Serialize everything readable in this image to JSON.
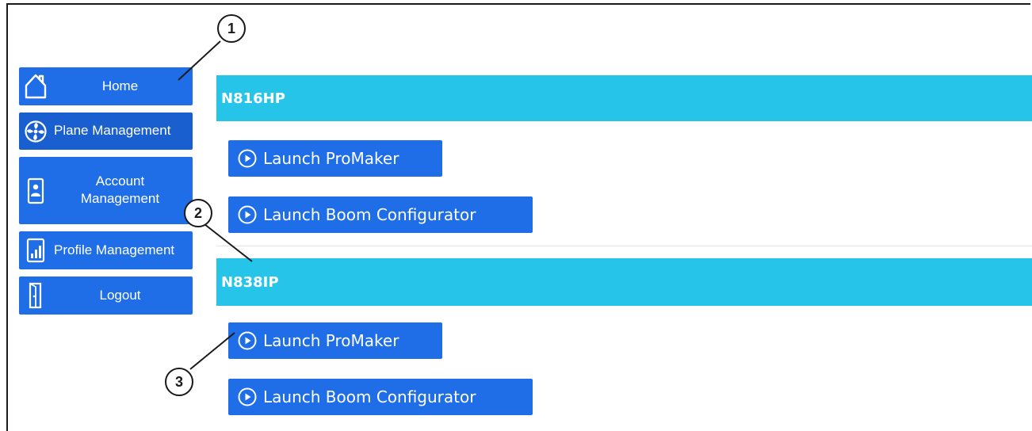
{
  "sidebar": {
    "items": [
      {
        "label": "Home",
        "icon": "home-icon"
      },
      {
        "label": "Plane Management",
        "icon": "fan-icon"
      },
      {
        "label": "Account Management",
        "label_line1": "Account",
        "label_line2": "Management",
        "icon": "phone-icon"
      },
      {
        "label": "Profile Management",
        "icon": "bar-chart-icon"
      },
      {
        "label": "Logout",
        "icon": "door-icon"
      }
    ]
  },
  "planes": [
    {
      "tail": "N816HP",
      "buttons": [
        {
          "label": "Launch ProMaker"
        },
        {
          "label": "Launch Boom Configurator"
        }
      ]
    },
    {
      "tail": "N838IP",
      "buttons": [
        {
          "label": "Launch ProMaker"
        },
        {
          "label": "Launch Boom Configurator"
        }
      ]
    }
  ],
  "callouts": [
    "1",
    "2",
    "3"
  ],
  "colors": {
    "button_blue": "#1f6ee8",
    "header_cyan": "#27c4ea",
    "text": "#ffffff"
  }
}
